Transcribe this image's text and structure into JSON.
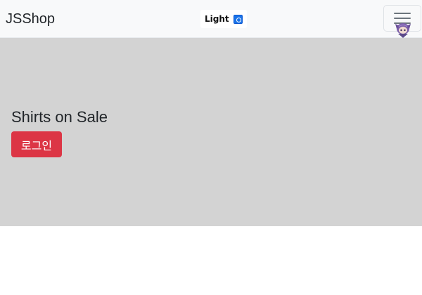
{
  "navbar": {
    "brand": "JSShop",
    "theme_toggle": {
      "label": "Light",
      "checked": true,
      "icon": "checkbox-icon"
    },
    "menu_icon": "hamburger-menu-icon",
    "mascot_icon": "mascot-character-icon"
  },
  "hero": {
    "title": "Shirts on Sale",
    "login_button": "로그인"
  },
  "colors": {
    "navbar_bg": "#f8f9fa",
    "hero_bg": "#d3d3d3",
    "button_bg": "#dc3545",
    "checkbox": "#1a73e8"
  }
}
